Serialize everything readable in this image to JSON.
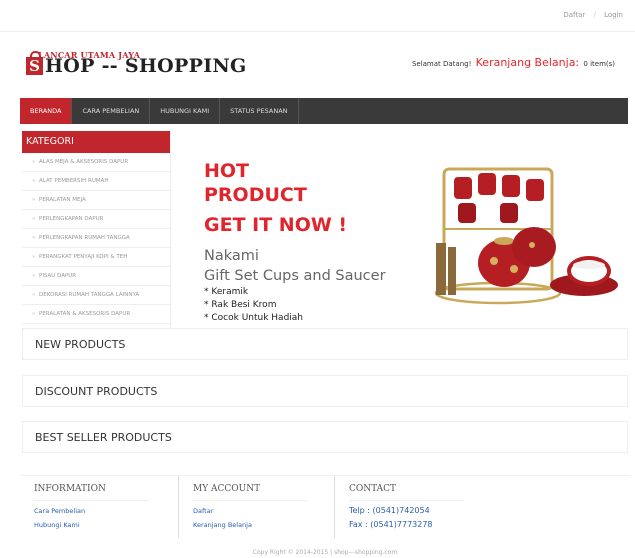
{
  "top_links": {
    "register": "Daftar",
    "separator": "/",
    "login": "Login"
  },
  "logo": {
    "tagline": "LANCAR UTAMA JAYA",
    "initial": "S",
    "name": "HOP -- SHOPPING",
    "bag_icon": "shopping-bag-icon"
  },
  "header": {
    "welcome": "Selamat Datang!",
    "cart_label": "Keranjang Belanja:",
    "cart_count": "0 item(s)"
  },
  "nav": {
    "items": [
      "BERANDA",
      "CARA PEMBELIAN",
      "HUBUNGI KAMI",
      "STATUS PESANAN"
    ],
    "active": "BERANDA"
  },
  "sidebar": {
    "title": "KATEGORI",
    "items": [
      "ALAS MEJA & AKSESORIS DAPUR",
      "ALAT PEMBERSIH RUMAH",
      "PERALATAN MEJA",
      "PERLENGKAPAN DAPUR",
      "PERLENGKAPAN RUMAH TANGGA",
      "PERANGKAT PENYAJI KOPI & TEH",
      "PISAU DAPUR",
      "DEKORASI RUMAH TANGGA LAINNYA",
      "PERALATAN & AKSESORIS DAPUR"
    ]
  },
  "banner": {
    "hot_line1": "HOT",
    "hot_line2": "PRODUCT",
    "cta": "GET IT NOW !",
    "product_brand": "Nakami",
    "product_name": "Gift Set Cups and Saucer",
    "features": [
      "Keramik",
      "Rak Besi Krom",
      "Cocok Untuk Hadiah"
    ]
  },
  "sections": {
    "new": "NEW PRODUCTS",
    "discount": "DISCOUNT PRODUCTS",
    "bestseller": "BEST SELLER PRODUCTS"
  },
  "footer": {
    "information": {
      "title": "INFORMATION",
      "links": [
        "Cara Pembelian",
        "Hubungi Kami"
      ]
    },
    "account": {
      "title": "MY ACCOUNT",
      "links": [
        "Daftar",
        "Keranjang Belanja"
      ]
    },
    "contact": {
      "title": "CONTACT",
      "phone": "Telp : (0541)742054",
      "fax": "Fax : (0541)7773278"
    },
    "copyright": "Copy Right © 2014-2015 | shop---shopping.com"
  },
  "colors": {
    "brand_red": "#c0262c",
    "nav_bg": "#3a3a3a",
    "link_blue": "#2a5db0"
  }
}
